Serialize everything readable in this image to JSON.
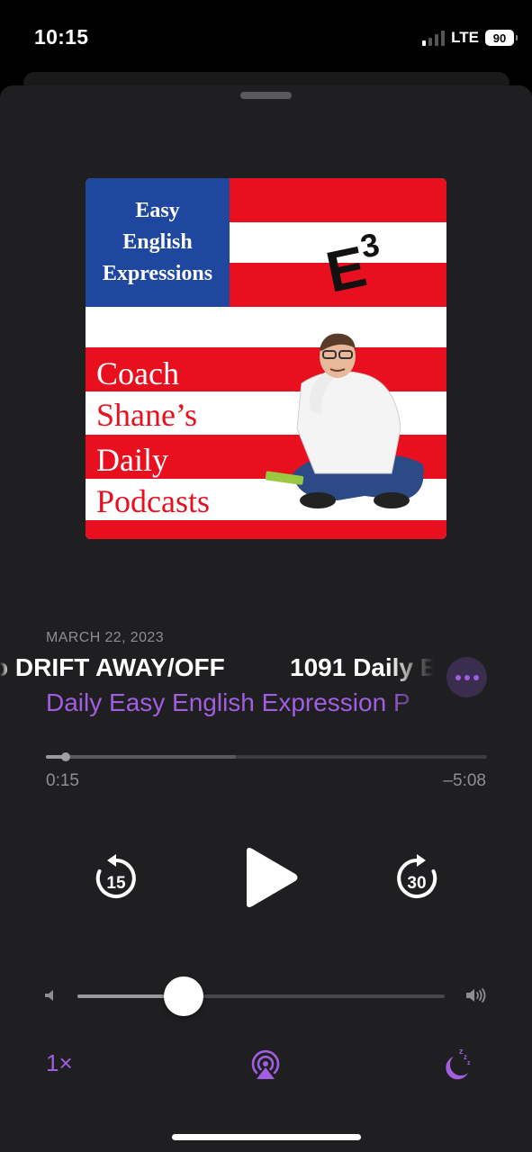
{
  "status_bar": {
    "time": "10:15",
    "network": "LTE",
    "battery": "90",
    "signal_bars_active": 1
  },
  "artwork": {
    "canton_lines": [
      "Easy",
      "English",
      "Expressions"
    ],
    "logo": "E",
    "logo_sup": "3",
    "text_lines": [
      "Coach",
      "Shane’s",
      "Daily",
      "Podcasts"
    ],
    "colors": {
      "red": "#e8101e",
      "blue": "#1f47a0",
      "white": "#ffffff"
    }
  },
  "episode": {
    "date": "MARCH 22, 2023",
    "title_fragment_a": "o DRIFT AWAY/OFF",
    "title_fragment_b": "1091 Daily E",
    "show": "Daily Easy English Expression P"
  },
  "playback": {
    "elapsed": "0:15",
    "remaining": "–5:08",
    "progress": 0.045,
    "buffered": 0.43,
    "skip_back_seconds": "15",
    "skip_forward_seconds": "30",
    "volume": 0.29,
    "speed": "1×"
  },
  "icons": {
    "more": "ellipsis-icon",
    "play": "play-icon",
    "skip_back": "skip-back-15-icon",
    "skip_forward": "skip-forward-30-icon",
    "volume_low": "speaker-low-icon",
    "volume_high": "speaker-high-icon",
    "airplay": "airplay-audio-icon",
    "sleep": "sleep-timer-moon-icon"
  },
  "theme": {
    "accent": "#a15ee0",
    "sheet_bg": "#1f1f21",
    "secondary_text": "#8e8e93"
  }
}
